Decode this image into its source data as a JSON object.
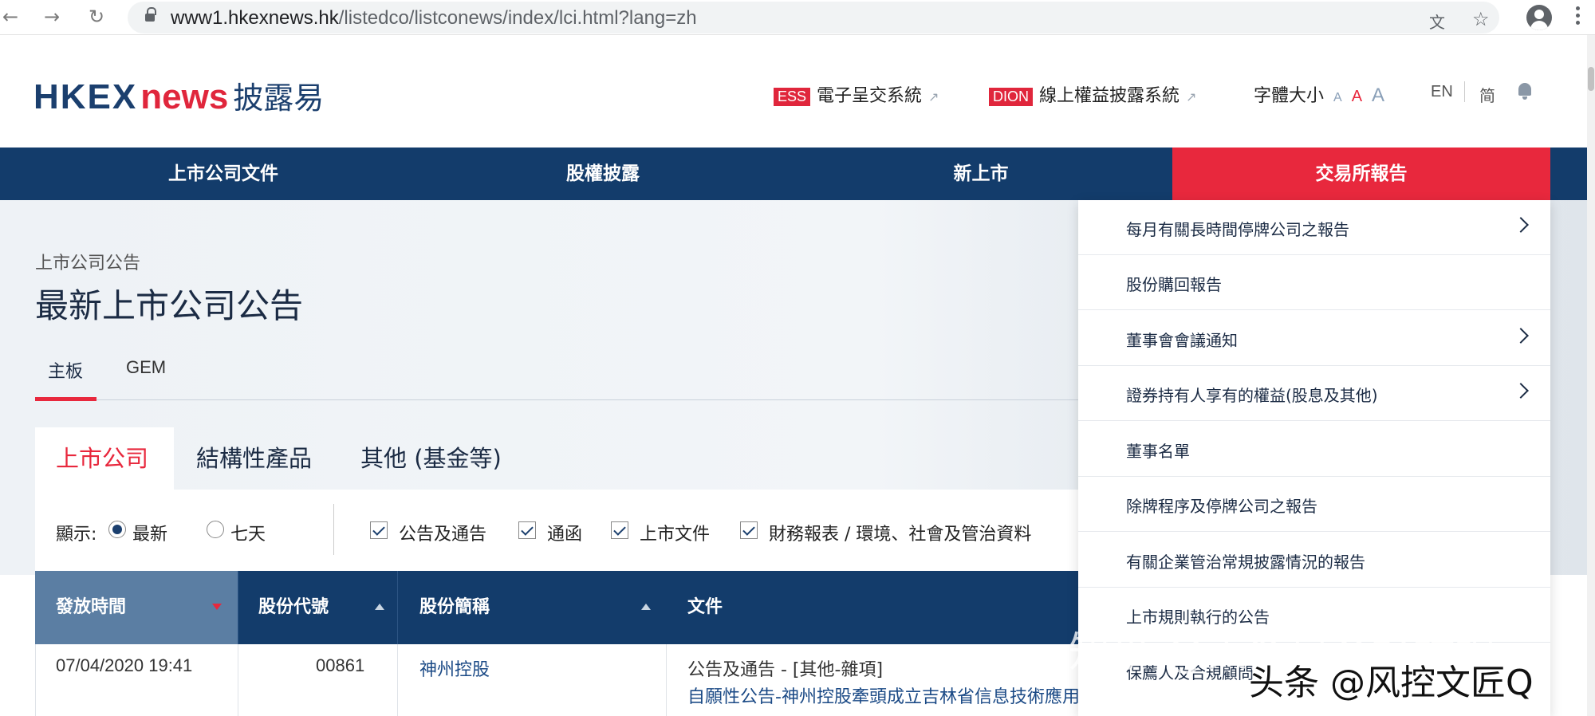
{
  "browser": {
    "back": "←",
    "forward": "→",
    "reload": "↻",
    "url_host": "www1.hkexnews.hk",
    "url_path": "/listedco/listconews/index/lci.html?lang=zh",
    "translate_icon": "文",
    "star_icon": "☆"
  },
  "header": {
    "logo_hkex": "HKEX",
    "logo_news": "news",
    "logo_cn": "披露易",
    "ess_tag": "ESS",
    "ess_label": "電子呈交系統",
    "dion_tag": "DION",
    "dion_label": "線上權益披露系統",
    "ext_icon": "↗",
    "fontsize_label": "字體大小",
    "fontsize_small": "A",
    "fontsize_medium": "A",
    "fontsize_large": "A",
    "lang_en": "EN",
    "lang_sc": "简"
  },
  "mainnav": [
    "上市公司文件",
    "股權披露",
    "新上市",
    "交易所報告"
  ],
  "page": {
    "breadcrumb": "上市公司公告",
    "title": "最新上市公司公告",
    "board_tabs": [
      "主板",
      "GEM"
    ],
    "category_tabs": [
      "上市公司",
      "結構性產品",
      "其他 (基金等)"
    ]
  },
  "filters": {
    "show_label": "顯示:",
    "radio_latest": "最新",
    "radio_seven": "七天",
    "checkboxes": [
      "公告及通告",
      "通函",
      "上市文件",
      "財務報表 / 環境、社會及管治資料"
    ]
  },
  "table": {
    "headers": [
      "發放時間",
      "股份代號",
      "股份簡稱",
      "文件"
    ],
    "row": {
      "time": "07/04/2020 19:41",
      "code": "00861",
      "name": "神州控股",
      "doc_category": "公告及通告 - [其他-雜項]",
      "doc_title": "自願性公告-神州控股牽頭成立吉林省信息技術應用創新產業聯盟"
    }
  },
  "dropdown": {
    "items": [
      {
        "label": "每月有關長時間停牌公司之報告",
        "has_submenu": true
      },
      {
        "label": "股份購回報告",
        "has_submenu": false
      },
      {
        "label": "董事會會議通知",
        "has_submenu": true
      },
      {
        "label": "證券持有人享有的權益(股息及其他)",
        "has_submenu": true
      },
      {
        "label": "董事名單",
        "has_submenu": false
      },
      {
        "label": "除牌程序及停牌公司之報告",
        "has_submenu": false
      },
      {
        "label": "有關企業管治常規披露情況的報告",
        "has_submenu": false
      },
      {
        "label": "上市規則執行的公告",
        "has_submenu": false
      },
      {
        "label": "保薦人及合規顧問",
        "has_submenu": false
      }
    ]
  },
  "watermark": {
    "line1": "知乎 @大多是个好姑娘",
    "line2": "头条 @风控文匠Q"
  },
  "colors": {
    "navy": "#133c6b",
    "red": "#e8283d",
    "header_first_col": "#5b7ea3"
  }
}
